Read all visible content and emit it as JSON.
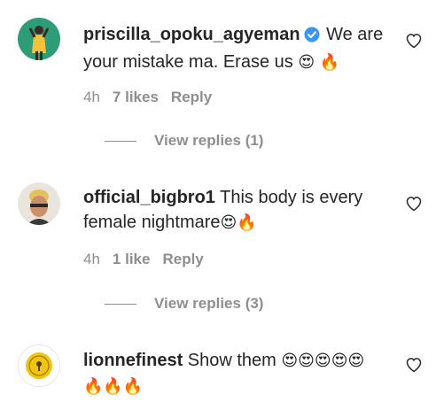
{
  "comments": [
    {
      "username": "priscilla_opoku_agyeman",
      "verified": true,
      "text": " We are your mistake ma. Erase us ",
      "emoji": "😍 🔥",
      "time": "4h",
      "likes": "7 likes",
      "reply_label": "Reply",
      "view_replies": "View replies (1)"
    },
    {
      "username": "official_bigbro1",
      "verified": false,
      "text": " This body is every female nightmare",
      "emoji": "😍🔥",
      "time": "4h",
      "likes": "1 like",
      "reply_label": "Reply",
      "view_replies": "View replies (3)"
    },
    {
      "username": "lionnefinest",
      "verified": false,
      "text": " Show them ",
      "emoji": "😍😍😍😍😍",
      "emoji_line2": "🔥🔥🔥"
    }
  ],
  "colors": {
    "text": "#262626",
    "muted": "#8e8e8e",
    "verified": "#3897f0"
  }
}
